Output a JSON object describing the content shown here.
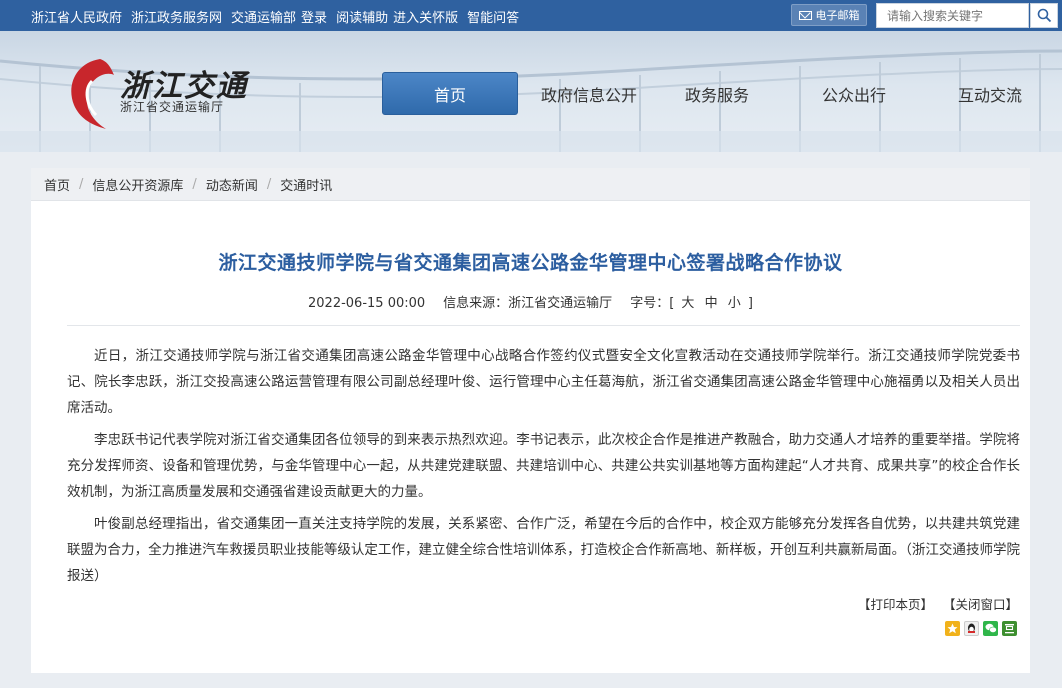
{
  "topbar": {
    "links": [
      "浙江省人民政府",
      "浙江政务服务网",
      "交通运输部",
      "登录",
      "阅读辅助",
      "进入关怀版",
      "智能问答"
    ],
    "mail_label": "电子邮箱",
    "search_placeholder": "请输入搜索关键字"
  },
  "header": {
    "logo_title": "浙江交通",
    "logo_subtitle": "浙江省交通运输厅"
  },
  "nav": {
    "items": [
      "首页",
      "政府信息公开",
      "政务服务",
      "公众出行",
      "互动交流"
    ],
    "active_index": 0
  },
  "breadcrumb": [
    "首页",
    "信息公开资源库",
    "动态新闻",
    "交通时讯"
  ],
  "article": {
    "title": "浙江交通技师学院与省交通集团高速公路金华管理中心签署战略合作协议",
    "date": "2022-06-15 00:00",
    "source_label": "信息来源：浙江省交通运输厅",
    "font_size_label": "字号：",
    "font_sizes": [
      "大",
      "中",
      "小"
    ],
    "bracket_open": "[",
    "bracket_close": "]",
    "paragraphs": [
      "近日，浙江交通技师学院与浙江省交通集团高速公路金华管理中心战略合作签约仪式暨安全文化宣教活动在交通技师学院举行。浙江交通技师学院党委书记、院长李忠跃，浙江交投高速公路运营管理有限公司副总经理叶俊、运行管理中心主任葛海航，浙江省交通集团高速公路金华管理中心施福勇以及相关人员出席活动。",
      "李忠跃书记代表学院对浙江省交通集团各位领导的到来表示热烈欢迎。李书记表示，此次校企合作是推进产教融合，助力交通人才培养的重要举措。学院将充分发挥师资、设备和管理优势，与金华管理中心一起，从共建党建联盟、共建培训中心、共建公共实训基地等方面构建起“人才共育、成果共享”的校企合作长效机制，为浙江高质量发展和交通强省建设贡献更大的力量。",
      "叶俊副总经理指出，省交通集团一直关注支持学院的发展，关系紧密、合作广泛，希望在今后的合作中，校企双方能够充分发挥各自优势，以共建共筑党建联盟为合力，全力推进汽车救援员职业技能等级认定工作，建立健全综合性培训体系，打造校企合作新高地、新样板，开创互利共赢新局面。（浙江交通技师学院报送）"
    ],
    "print_label": "【打印本页】",
    "close_label": "【关闭窗口】"
  },
  "share_icons": [
    "qzone-icon",
    "qq-icon",
    "wechat-icon",
    "douban-icon"
  ],
  "colors": {
    "topbar": "#2f61a0",
    "nav_active": "#3a78bb",
    "title": "#2c5ea0"
  }
}
